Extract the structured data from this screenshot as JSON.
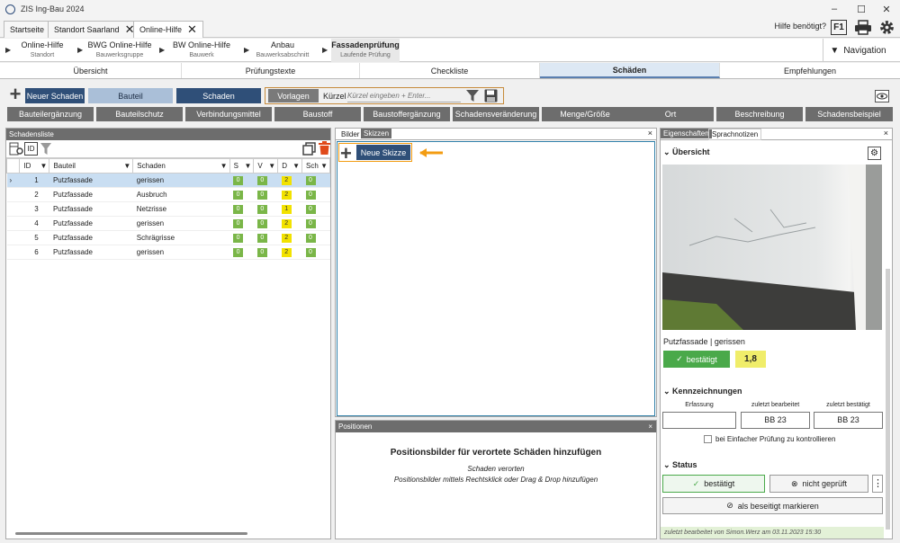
{
  "window": {
    "title": "ZIS Ing-Bau 2024",
    "controls": [
      "–",
      "☐",
      "✕"
    ]
  },
  "tabs": [
    {
      "label": "Startseite"
    },
    {
      "label": "Standort Saarland"
    },
    {
      "label": "Online-Hilfe"
    }
  ],
  "help": {
    "label": "Hilfe benötigt?",
    "f1": "F1"
  },
  "breadcrumb": [
    {
      "title": "Online-Hilfe",
      "sub": "Standort"
    },
    {
      "title": "BWG Online-Hilfe",
      "sub": "Bauwerksgruppe"
    },
    {
      "title": "BW Online-Hilfe",
      "sub": "Bauwerk"
    },
    {
      "title": "Anbau",
      "sub": "Bauwerksabschnitt"
    },
    {
      "title": "Fassadenprüfung",
      "sub": "Laufende Prüfung"
    }
  ],
  "navigation": "Navigation",
  "section_tabs": [
    "Übersicht",
    "Prüfungstexte",
    "Checkliste",
    "Schäden",
    "Empfehlungen"
  ],
  "toolbar": {
    "new_damage": "Neuer Schaden",
    "bauteil": "Bauteil",
    "schaden": "Schaden",
    "vorlagen": "Vorlagen",
    "kuerzel_label": "Kürzel",
    "kuerzel_placeholder": "Kürzel eingeben + Enter..."
  },
  "categories": [
    "Bauteilergänzung",
    "Bauteilschutz",
    "Verbindungsmittel",
    "Baustoff",
    "Baustoffergänzung",
    "Schadensveränderung",
    "Menge/Größe",
    "Ort",
    "Beschreibung",
    "Schadensbeispiel"
  ],
  "schadensliste": {
    "title": "Schadensliste",
    "columns": [
      "ID",
      "Bauteil",
      "Schaden",
      "S",
      "V",
      "D",
      "Sch"
    ],
    "rows": [
      {
        "id": "1",
        "bauteil": "Putzfassade",
        "schaden": "gerissen",
        "s": "0",
        "v": "0",
        "d": "2",
        "sch": "0"
      },
      {
        "id": "2",
        "bauteil": "Putzfassade",
        "schaden": "Ausbruch",
        "s": "0",
        "v": "0",
        "d": "2",
        "sch": "0"
      },
      {
        "id": "3",
        "bauteil": "Putzfassade",
        "schaden": "Netzrisse",
        "s": "0",
        "v": "0",
        "d": "1",
        "sch": "0"
      },
      {
        "id": "4",
        "bauteil": "Putzfassade",
        "schaden": "gerissen",
        "s": "0",
        "v": "0",
        "d": "2",
        "sch": "0"
      },
      {
        "id": "5",
        "bauteil": "Putzfassade",
        "schaden": "Schrägrisse",
        "s": "0",
        "v": "0",
        "d": "2",
        "sch": "0"
      },
      {
        "id": "6",
        "bauteil": "Putzfassade",
        "schaden": "gerissen",
        "s": "0",
        "v": "0",
        "d": "2",
        "sch": "0"
      }
    ]
  },
  "media": {
    "tabs": [
      "Bilder",
      "Skizzen"
    ],
    "new_sketch": "Neue Skizze"
  },
  "positionen": {
    "title": "Positionen",
    "heading": "Positionsbilder für verortete Schäden hinzufügen",
    "line1": "Schaden verorten",
    "line2": "Positionsbilder mittels Rechtsklick oder Drag & Drop hinzufügen"
  },
  "properties": {
    "tabs": [
      "Eigenschaften",
      "Sprachnotizen"
    ],
    "overview": "Übersicht",
    "caption": "Putzfassade | gerissen",
    "status_btn": "bestätigt",
    "score": "1,8",
    "kennzeichnungen": "Kennzeichnungen",
    "k_cols": [
      {
        "label": "Erfassung",
        "value": ""
      },
      {
        "label": "zuletzt bearbeitet",
        "value": "BB 23"
      },
      {
        "label": "zuletzt bestätigt",
        "value": "BB 23"
      }
    ],
    "check_label": "bei Einfacher Prüfung zu kontrollieren",
    "status": "Status",
    "confirmed": "bestätigt",
    "not_checked": "nicht geprüft",
    "mark_fixed": "als beseitigt markieren",
    "footer_prefix": "zuletzt bearbeitet von",
    "footer_user": "Simon.Werz",
    "footer_mid": "am",
    "footer_date": "03.11.2023 15:30"
  },
  "colors": {
    "primary": "#2f4f78",
    "light": "#aabfd8",
    "green": "#7ab648",
    "yellow": "#f2e200",
    "orange": "#f39c12"
  }
}
